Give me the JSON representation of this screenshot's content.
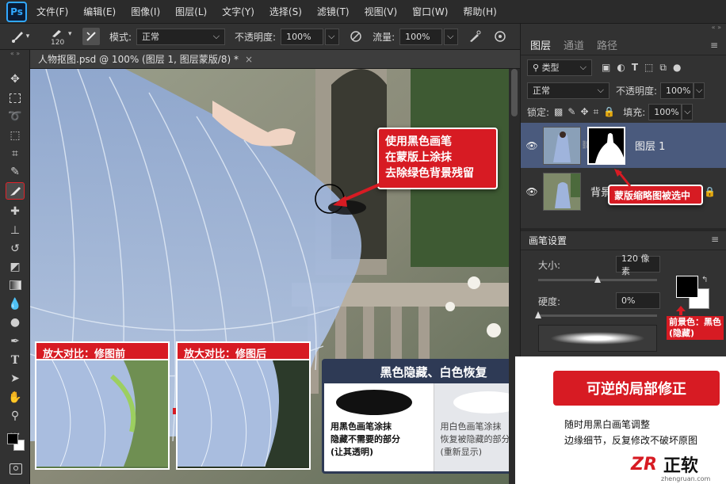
{
  "app": {
    "logo": "Ps"
  },
  "menu": [
    "文件(F)",
    "编辑(E)",
    "图像(I)",
    "图层(L)",
    "文字(Y)",
    "选择(S)",
    "滤镜(T)",
    "视图(V)",
    "窗口(W)",
    "帮助(H)"
  ],
  "options": {
    "brush_size": "120",
    "mode_label": "模式:",
    "mode_value": "正常",
    "opacity_label": "不透明度:",
    "opacity_value": "100%",
    "flow_label": "流量:",
    "flow_value": "100%"
  },
  "document": {
    "tab_title": "人物抠图.psd @ 100% (图层 1, 图层蒙版/8) *"
  },
  "layers_panel": {
    "tabs": [
      "图层",
      "通道",
      "路径"
    ],
    "filter_label": "类型",
    "blend_mode": "正常",
    "opacity_label": "不透明度:",
    "opacity_value": "100%",
    "lock_label": "锁定:",
    "fill_label": "填充:",
    "fill_value": "100%",
    "layers": [
      {
        "name": "图层 1"
      },
      {
        "name": "背景"
      }
    ]
  },
  "brush_panel": {
    "title": "画笔设置",
    "size_label": "大小:",
    "size_value": "120 像素",
    "size_fraction": 0.5,
    "hardness_label": "硬度:",
    "hardness_value": "0%",
    "hardness_fraction": 0.0
  },
  "annotations": {
    "brush_tip": "使用黑色画笔\n在蒙版上涂抹\n去除绿色背景残留",
    "mask_selected": "蒙版缩略图被选中",
    "foreground_note": "前景色：黑色\n(隐藏)",
    "before_label": "放大对比：修图前",
    "after_label": "放大对比：修图后",
    "rule_title": "黑色隐藏、白色恢复",
    "black_desc": "用黑色画笔涂抹\n隐藏不需要的部分\n(让其透明)",
    "white_desc": "用白色画笔涂抹\n恢复被隐藏的部分\n(重新显示)",
    "reversible_title": "可逆的局部修正",
    "reversible_desc": "随时用黑白画笔调整\n边缘细节，反复修改不破坏原图"
  },
  "brand": {
    "logo_text": "ZR",
    "name": "正软",
    "domain": "zhengruan.com"
  },
  "colors": {
    "accent_red": "#d71b23",
    "navy": "#2e3a55",
    "ps_blue": "#31a8ff",
    "layer_selected": "#4a5a7d"
  }
}
